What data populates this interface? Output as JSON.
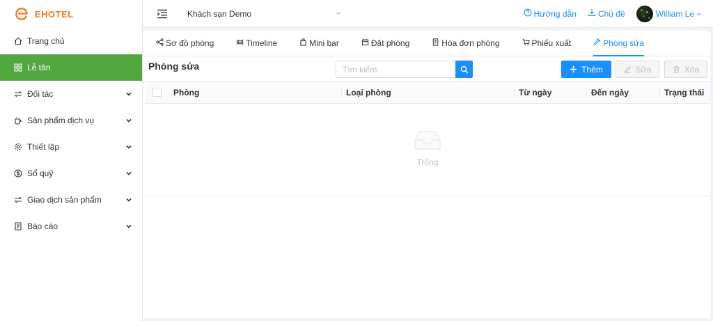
{
  "app": {
    "brand": "EHOTEL",
    "brand_color": "#f47b20",
    "accent": "#1890ff",
    "active_menu_color": "#52a83f"
  },
  "sidebar": {
    "items": [
      {
        "label": "Trang chủ",
        "icon": "home-icon",
        "expandable": false,
        "active": false
      },
      {
        "label": "Lễ tân",
        "icon": "grid-icon",
        "expandable": false,
        "active": true
      },
      {
        "label": "Đối tác",
        "icon": "swap-icon",
        "expandable": true,
        "active": false
      },
      {
        "label": "Sản phẩm dịch vụ",
        "icon": "cup-icon",
        "expandable": true,
        "active": false
      },
      {
        "label": "Thiết lập",
        "icon": "gear-icon",
        "expandable": true,
        "active": false
      },
      {
        "label": "Sổ quỹ",
        "icon": "dollar-icon",
        "expandable": true,
        "active": false
      },
      {
        "label": "Giao dịch sản phẩm",
        "icon": "swap-icon",
        "expandable": true,
        "active": false
      },
      {
        "label": "Báo cáo",
        "icon": "report-icon",
        "expandable": true,
        "active": false
      }
    ]
  },
  "header": {
    "hotel": "Khách sạn Demo",
    "guide": "Hướng dẫn",
    "theme": "Chủ đề",
    "user": "William Le"
  },
  "tabs": [
    {
      "label": "Sơ đồ phòng",
      "icon": "room-map-icon",
      "active": false
    },
    {
      "label": "Timeline",
      "icon": "timeline-icon",
      "active": false
    },
    {
      "label": "Mini bar",
      "icon": "bag-icon",
      "active": false
    },
    {
      "label": "Đặt phòng",
      "icon": "calendar-icon",
      "active": false
    },
    {
      "label": "Hóa đơn phòng",
      "icon": "invoice-icon",
      "active": false
    },
    {
      "label": "Phiếu xuất",
      "icon": "cart-icon",
      "active": false
    },
    {
      "label": "Phòng sửa",
      "icon": "wrench-icon",
      "active": true
    }
  ],
  "main": {
    "title": "Phòng sửa",
    "search_placeholder": "Tìm kiếm",
    "add_label": "Thêm",
    "edit_label": "Sửa",
    "delete_label": "Xóa",
    "columns": [
      "Phòng",
      "Loại phòng",
      "Từ ngày",
      "Đến ngày",
      "Trạng thái"
    ],
    "rows": [],
    "empty_text": "Trống"
  }
}
